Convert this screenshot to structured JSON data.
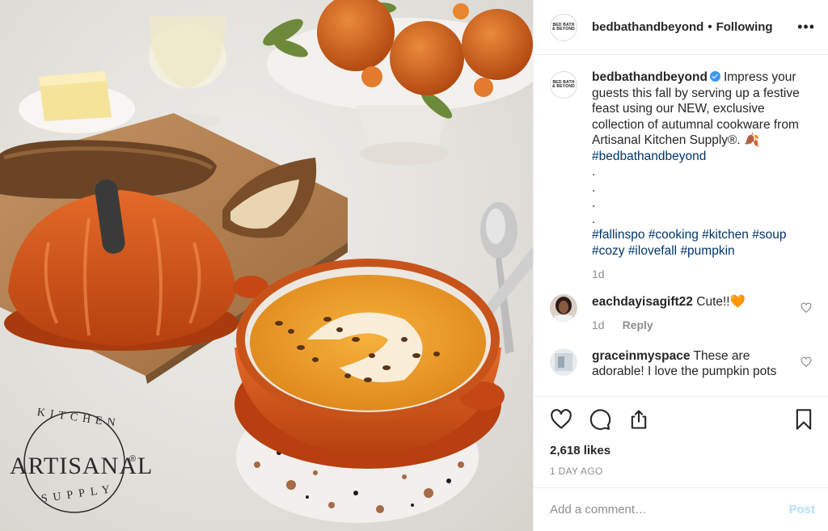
{
  "post_image": {
    "logo_top": "KITCHEN",
    "logo_main": "ARTISANAL",
    "logo_bottom": "SUPPLY",
    "logo_reg": "®"
  },
  "header": {
    "avatar_text": "BED BATH & BEYOND",
    "username": "bedbathandbeyond",
    "separator": "•",
    "follow_status": "Following",
    "more_icon": "ellipsis-icon"
  },
  "caption": {
    "username": "bedbathandbeyond",
    "verified": true,
    "text": "Impress your guests this fall by serving up a festive feast using our NEW, exclusive collection of autumnal cookware from Artisanal Kitchen Supply®. 🍂",
    "hashtag_first": "#bedbathandbeyond",
    "dots": [
      ".",
      ".",
      ".",
      "."
    ],
    "hashtags": [
      "#fallinspo",
      "#cooking",
      "#kitchen",
      "#soup",
      "#cozy",
      "#ilovefall",
      "#pumpkin"
    ],
    "age": "1d"
  },
  "comments": [
    {
      "username": "eachdayisagift22",
      "text": "Cute!!🧡",
      "age": "1d",
      "reply_label": "Reply"
    },
    {
      "username": "graceinmyspace",
      "text": "These are adorable! I love the pumpkin pots"
    }
  ],
  "actions": {
    "like_icon": "heart-icon",
    "comment_icon": "comment-icon",
    "share_icon": "share-icon",
    "save_icon": "bookmark-icon",
    "likes": "2,618 likes",
    "time_ago": "1 DAY AGO"
  },
  "composer": {
    "placeholder": "Add a comment…",
    "post_label": "Post"
  },
  "colors": {
    "verified": "#3897f0",
    "hashtag": "#003569",
    "muted": "#8e8e8e",
    "post_disabled": "#b2dffc"
  }
}
